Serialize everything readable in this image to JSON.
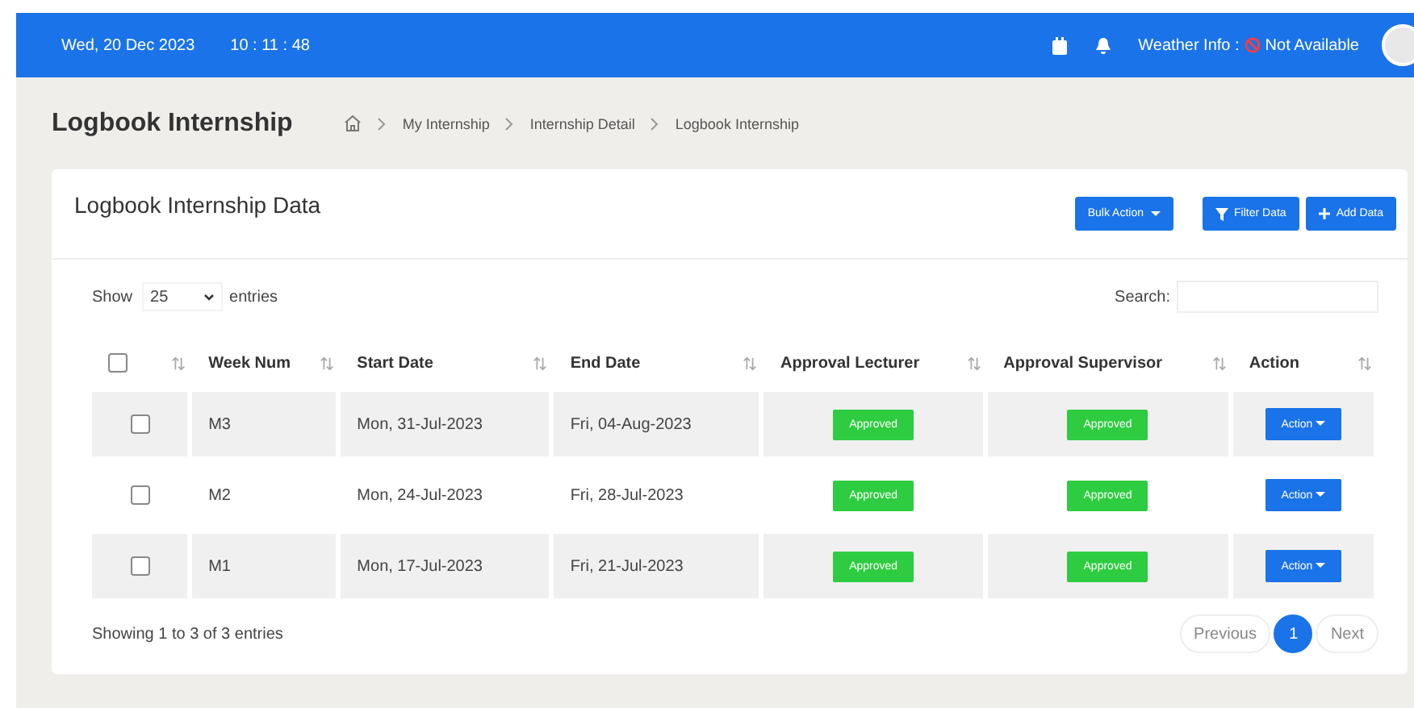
{
  "header": {
    "date": "Wed, 20 Dec 2023",
    "time": "10 : 11 : 48",
    "weather_label": "Weather Info :",
    "weather_value": "Not Available"
  },
  "page": {
    "title": "Logbook Internship",
    "breadcrumb": [
      "My Internship",
      "Internship Detail",
      "Logbook Internship"
    ]
  },
  "card": {
    "title": "Logbook Internship Data",
    "buttons": [
      {
        "label": "Bulk Action",
        "kind": "dropdown"
      },
      {
        "label": "Filter Data",
        "kind": "filter"
      },
      {
        "label": "Add Data",
        "kind": "add"
      }
    ]
  },
  "length_menu": {
    "before": "Show",
    "value": "25",
    "after": "entries"
  },
  "search": {
    "label": "Search:"
  },
  "table": {
    "select_all_checked": false,
    "columns": [
      "Week Num",
      "Start Date",
      "End Date",
      "Approval Lecturer",
      "Approval Supervisor",
      "Action"
    ],
    "rows": [
      {
        "checked": false,
        "week": "M3",
        "start": "Mon, 31-Jul-2023",
        "end": "Fri, 04-Aug-2023",
        "lecturer": "Approved",
        "supervisor": "Approved",
        "action": "Action"
      },
      {
        "checked": false,
        "week": "M2",
        "start": "Mon, 24-Jul-2023",
        "end": "Fri, 28-Jul-2023",
        "lecturer": "Approved",
        "supervisor": "Approved",
        "action": "Action"
      },
      {
        "checked": false,
        "week": "M1",
        "start": "Mon, 17-Jul-2023",
        "end": "Fri, 21-Jul-2023",
        "lecturer": "Approved",
        "supervisor": "Approved",
        "action": "Action"
      }
    ]
  },
  "info": "Showing 1 to 3 of 3 entries",
  "pagination": [
    {
      "label": "Previous",
      "kind": "nav",
      "selected": false
    },
    {
      "label": "1",
      "kind": "page",
      "selected": true
    },
    {
      "label": "Next",
      "kind": "nav",
      "selected": false
    }
  ]
}
